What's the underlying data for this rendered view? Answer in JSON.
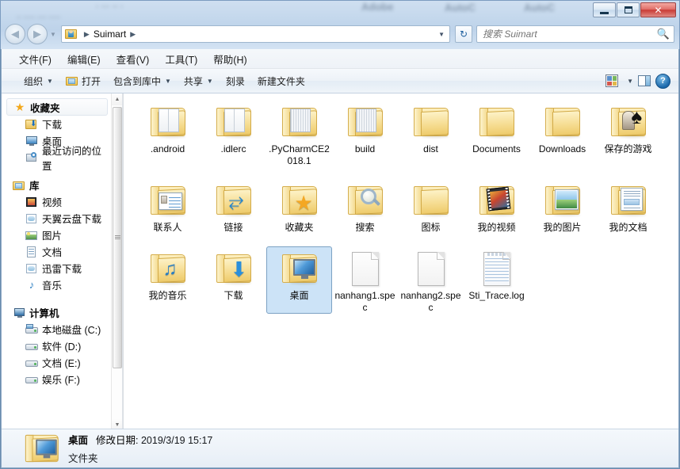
{
  "window": {
    "minimize_label": "Minimize",
    "maximize_label": "Maximize",
    "close_label": "✕",
    "ghost_titles": [
      "Adobe",
      "AutoC",
      "AutoC"
    ]
  },
  "address_bar": {
    "back_label": "◀",
    "forward_label": "▶",
    "history_caret": "▼",
    "breadcrumb": [
      "Suimart"
    ],
    "separator": "▶",
    "dropdown_caret": "▼",
    "refresh_label": "↻"
  },
  "search": {
    "placeholder": "搜索 Suimart",
    "value": "",
    "icon": "search-icon"
  },
  "menubar": {
    "items": [
      {
        "label": "文件(F)"
      },
      {
        "label": "编辑(E)"
      },
      {
        "label": "查看(V)"
      },
      {
        "label": "工具(T)"
      },
      {
        "label": "帮助(H)"
      }
    ]
  },
  "toolbar": {
    "organize": "组织",
    "open": "打开",
    "include_in_library": "包含到库中",
    "share": "共享",
    "burn": "刻录",
    "new_folder": "新建文件夹",
    "caret": "▼",
    "view_caret": "▼",
    "help_label": "?"
  },
  "nav_pane": {
    "groups": [
      {
        "name": "收藏夹",
        "icon": "star-icon",
        "selected": true,
        "items": [
          {
            "label": "下载",
            "icon": "download-icon"
          },
          {
            "label": "桌面",
            "icon": "desktop-icon"
          },
          {
            "label": "最近访问的位置",
            "icon": "recent-places-icon"
          }
        ]
      },
      {
        "name": "库",
        "icon": "library-icon",
        "selected": false,
        "items": [
          {
            "label": "视频",
            "icon": "video-icon"
          },
          {
            "label": "天翼云盘下载",
            "icon": "cloud-download-icon"
          },
          {
            "label": "图片",
            "icon": "pictures-icon"
          },
          {
            "label": "文档",
            "icon": "documents-icon"
          },
          {
            "label": "迅雷下载",
            "icon": "thunder-download-icon"
          },
          {
            "label": "音乐",
            "icon": "music-icon"
          }
        ]
      },
      {
        "name": "计算机",
        "icon": "computer-icon",
        "selected": false,
        "items": [
          {
            "label": "本地磁盘 (C:)",
            "icon": "system-drive-icon"
          },
          {
            "label": "软件 (D:)",
            "icon": "drive-icon"
          },
          {
            "label": "文档 (E:)",
            "icon": "drive-icon"
          },
          {
            "label": "娱乐 (F:)",
            "icon": "drive-icon"
          }
        ]
      }
    ],
    "scroll_up": "▲",
    "scroll_down": "▼"
  },
  "files": [
    {
      "name": ".android",
      "type": "folder",
      "overlay": "papers",
      "selected": false
    },
    {
      "name": ".idlerc",
      "type": "folder",
      "overlay": "papers",
      "selected": false
    },
    {
      "name": ".PyCharmCE2018.1",
      "type": "folder",
      "overlay": "stripes",
      "selected": false
    },
    {
      "name": "build",
      "type": "folder",
      "overlay": "stripes",
      "selected": false
    },
    {
      "name": "dist",
      "type": "folder",
      "overlay": "none",
      "selected": false
    },
    {
      "name": "Documents",
      "type": "folder",
      "overlay": "none",
      "selected": false
    },
    {
      "name": "Downloads",
      "type": "folder",
      "overlay": "none",
      "selected": false
    },
    {
      "name": "保存的游戏",
      "type": "folder",
      "overlay": "chess",
      "selected": false
    },
    {
      "name": "联系人",
      "type": "folder",
      "overlay": "card",
      "selected": false
    },
    {
      "name": "链接",
      "type": "folder",
      "overlay": "link",
      "selected": false
    },
    {
      "name": "收藏夹",
      "type": "folder",
      "overlay": "star",
      "selected": false
    },
    {
      "name": "搜索",
      "type": "folder",
      "overlay": "magnifier",
      "selected": false
    },
    {
      "name": "图标",
      "type": "folder",
      "overlay": "none",
      "selected": false
    },
    {
      "name": "我的视频",
      "type": "folder",
      "overlay": "film",
      "selected": false
    },
    {
      "name": "我的图片",
      "type": "folder",
      "overlay": "photo",
      "selected": false
    },
    {
      "name": "我的文档",
      "type": "folder",
      "overlay": "docpage",
      "selected": false
    },
    {
      "name": "我的音乐",
      "type": "folder",
      "overlay": "note",
      "selected": false
    },
    {
      "name": "下载",
      "type": "folder",
      "overlay": "downarrow",
      "selected": false
    },
    {
      "name": "桌面",
      "type": "folder",
      "overlay": "monitor",
      "selected": true
    },
    {
      "name": "nanhang1.spec",
      "type": "file",
      "overlay": "plain",
      "selected": false
    },
    {
      "name": "nanhang2.spec",
      "type": "file",
      "overlay": "plain",
      "selected": false
    },
    {
      "name": "Sti_Trace.log",
      "type": "file",
      "overlay": "log",
      "selected": false
    }
  ],
  "status_bar": {
    "name": "桌面",
    "modified_label": "修改日期:",
    "modified_value": "2019/3/19 15:17",
    "item_type": "文件夹"
  },
  "colors": {
    "selection_fill": "#cce3f7",
    "selection_border": "#7da2c4",
    "close_button": "#c93b35",
    "accent_blue": "#2a6fa8"
  }
}
